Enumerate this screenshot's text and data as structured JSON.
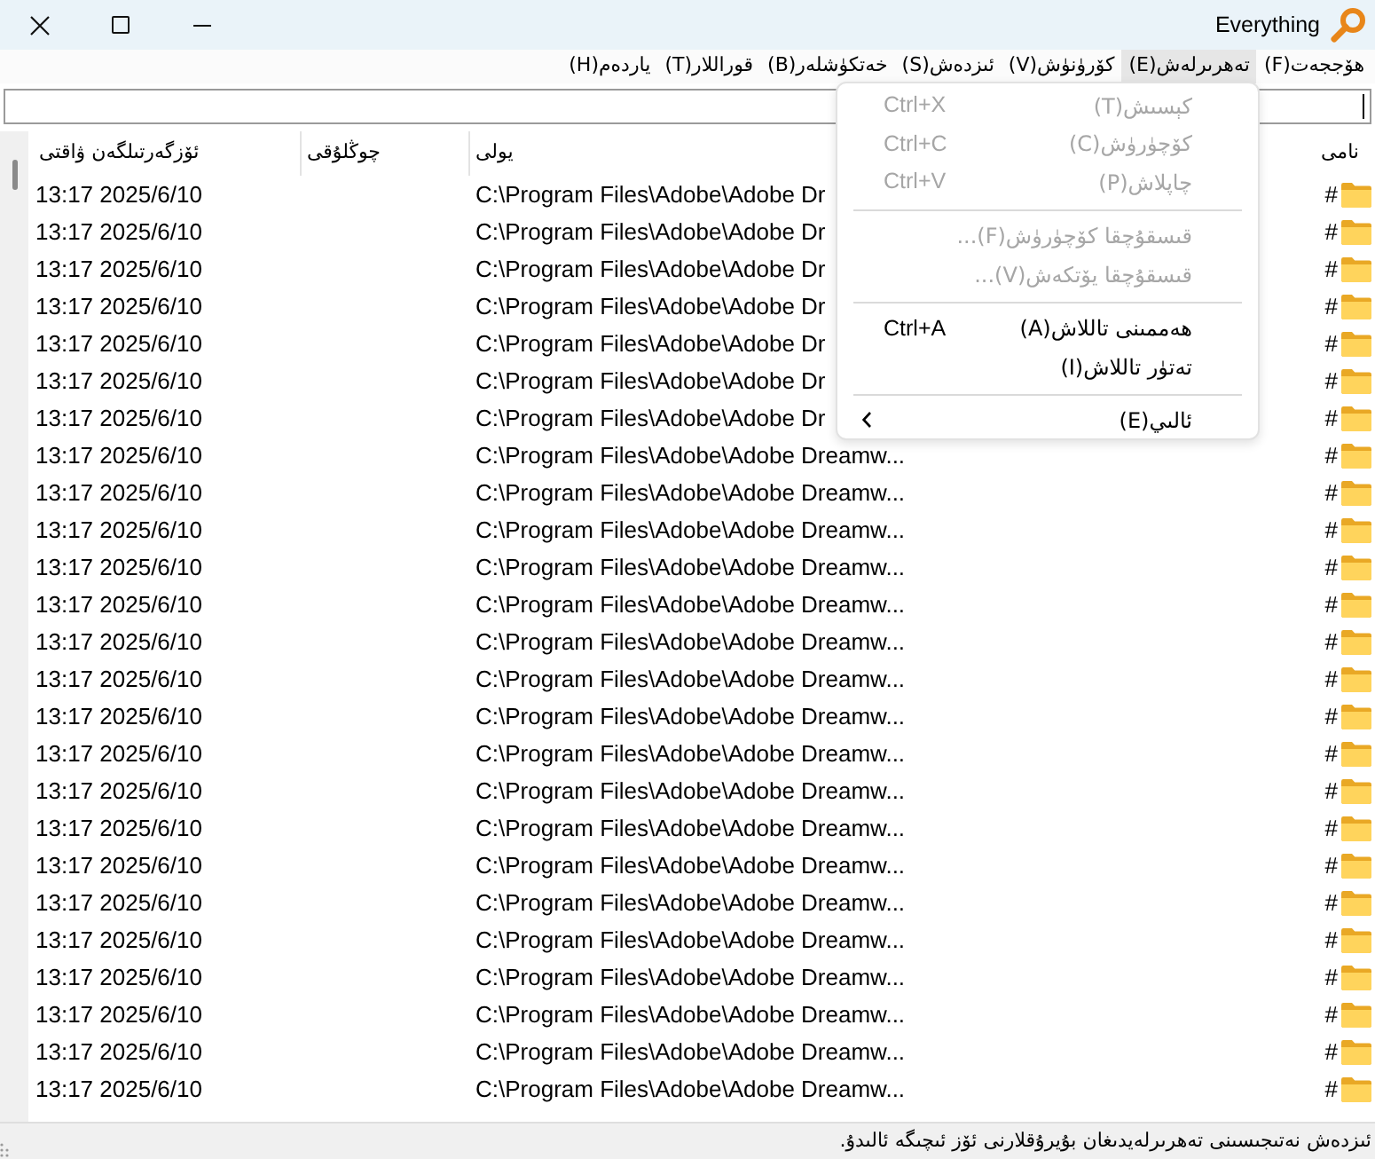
{
  "window": {
    "title": "Everything"
  },
  "menu_bar": [
    {
      "label": "ھۆججەت(F)",
      "selected": false
    },
    {
      "label": "تەھرىرلەش(E)",
      "selected": true
    },
    {
      "label": "كۆرۈنۈش(V)",
      "selected": false
    },
    {
      "label": "ئىزدەش(S)",
      "selected": false
    },
    {
      "label": "خەتكۈشلەر(B)",
      "selected": false
    },
    {
      "label": "قوراللار(T)",
      "selected": false
    },
    {
      "label": "ياردەم(H)",
      "selected": false
    }
  ],
  "table": {
    "columns": [
      "نامى",
      "يولى",
      "چوڭلۇقى",
      "ئۆزگەرتىلگەن ۋاقتى"
    ],
    "rows": [
      {
        "name": "#",
        "path": "C:\\Program Files\\Adobe\\Adobe Dr",
        "modified": "13:17 2025/6/10"
      },
      {
        "name": "#",
        "path": "C:\\Program Files\\Adobe\\Adobe Dr",
        "modified": "13:17 2025/6/10"
      },
      {
        "name": "#",
        "path": "C:\\Program Files\\Adobe\\Adobe Dr",
        "modified": "13:17 2025/6/10"
      },
      {
        "name": "#",
        "path": "C:\\Program Files\\Adobe\\Adobe Dr",
        "modified": "13:17 2025/6/10"
      },
      {
        "name": "#",
        "path": "C:\\Program Files\\Adobe\\Adobe Dr",
        "modified": "13:17 2025/6/10"
      },
      {
        "name": "#",
        "path": "C:\\Program Files\\Adobe\\Adobe Dr",
        "modified": "13:17 2025/6/10"
      },
      {
        "name": "#",
        "path": "C:\\Program Files\\Adobe\\Adobe Dr",
        "modified": "13:17 2025/6/10"
      },
      {
        "name": "#",
        "path": "C:\\Program Files\\Adobe\\Adobe Dreamw...",
        "modified": "13:17 2025/6/10"
      },
      {
        "name": "#",
        "path": "C:\\Program Files\\Adobe\\Adobe Dreamw...",
        "modified": "13:17 2025/6/10"
      },
      {
        "name": "#",
        "path": "C:\\Program Files\\Adobe\\Adobe Dreamw...",
        "modified": "13:17 2025/6/10"
      },
      {
        "name": "#",
        "path": "C:\\Program Files\\Adobe\\Adobe Dreamw...",
        "modified": "13:17 2025/6/10"
      },
      {
        "name": "#",
        "path": "C:\\Program Files\\Adobe\\Adobe Dreamw...",
        "modified": "13:17 2025/6/10"
      },
      {
        "name": "#",
        "path": "C:\\Program Files\\Adobe\\Adobe Dreamw...",
        "modified": "13:17 2025/6/10"
      },
      {
        "name": "#",
        "path": "C:\\Program Files\\Adobe\\Adobe Dreamw...",
        "modified": "13:17 2025/6/10"
      },
      {
        "name": "#",
        "path": "C:\\Program Files\\Adobe\\Adobe Dreamw...",
        "modified": "13:17 2025/6/10"
      },
      {
        "name": "#",
        "path": "C:\\Program Files\\Adobe\\Adobe Dreamw...",
        "modified": "13:17 2025/6/10"
      },
      {
        "name": "#",
        "path": "C:\\Program Files\\Adobe\\Adobe Dreamw...",
        "modified": "13:17 2025/6/10"
      },
      {
        "name": "#",
        "path": "C:\\Program Files\\Adobe\\Adobe Dreamw...",
        "modified": "13:17 2025/6/10"
      },
      {
        "name": "#",
        "path": "C:\\Program Files\\Adobe\\Adobe Dreamw...",
        "modified": "13:17 2025/6/10"
      },
      {
        "name": "#",
        "path": "C:\\Program Files\\Adobe\\Adobe Dreamw...",
        "modified": "13:17 2025/6/10"
      },
      {
        "name": "#",
        "path": "C:\\Program Files\\Adobe\\Adobe Dreamw...",
        "modified": "13:17 2025/6/10"
      },
      {
        "name": "#",
        "path": "C:\\Program Files\\Adobe\\Adobe Dreamw...",
        "modified": "13:17 2025/6/10"
      },
      {
        "name": "#",
        "path": "C:\\Program Files\\Adobe\\Adobe Dreamw...",
        "modified": "13:17 2025/6/10"
      },
      {
        "name": "#",
        "path": "C:\\Program Files\\Adobe\\Adobe Dreamw...",
        "modified": "13:17 2025/6/10"
      },
      {
        "name": "#",
        "path": "C:\\Program Files\\Adobe\\Adobe Dreamw...",
        "modified": "13:17 2025/6/10"
      }
    ]
  },
  "edit_menu": {
    "items": [
      {
        "kind": "item",
        "label": "كېسىش(T)",
        "shortcut": "Ctrl+X",
        "disabled": true
      },
      {
        "kind": "item",
        "label": "كۆچۈرۈش(C)",
        "shortcut": "Ctrl+C",
        "disabled": true
      },
      {
        "kind": "item",
        "label": "چاپلاش(P)",
        "shortcut": "Ctrl+V",
        "disabled": true
      },
      {
        "kind": "separator"
      },
      {
        "kind": "item",
        "label": "قىسقۇچقا كۆچۈرۈش(F)...",
        "disabled": true
      },
      {
        "kind": "item",
        "label": "قىسقۇچقا يۆتكەش(V)...",
        "disabled": true
      },
      {
        "kind": "separator"
      },
      {
        "kind": "item",
        "label": "ھەممىنى تاللاش(A)",
        "shortcut": "Ctrl+A",
        "disabled": false
      },
      {
        "kind": "item",
        "label": "تەتۈر تاللاش(I)",
        "disabled": false
      },
      {
        "kind": "separator"
      },
      {
        "kind": "submenu",
        "label": "ئالىي(E)",
        "disabled": false
      }
    ]
  },
  "status_bar": {
    "text": "ئىزدەش نەتىجىسىنى تەھرىرلەيدىغان بۇيرۇقلارنى ئۆز ئىچىگە ئالىدۇ."
  }
}
